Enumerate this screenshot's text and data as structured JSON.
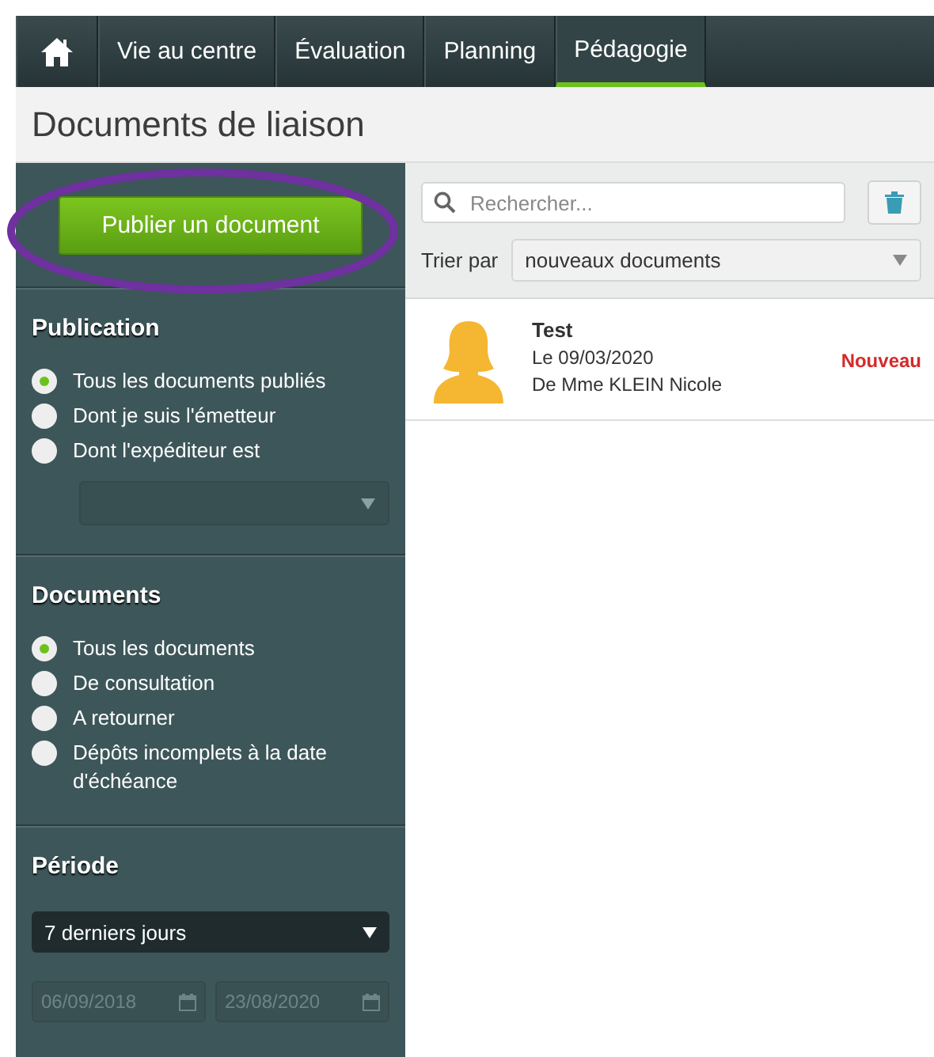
{
  "nav": {
    "tabs": [
      {
        "kind": "home",
        "selected": false
      },
      {
        "kind": "text",
        "label": "Vie au centre",
        "selected": false
      },
      {
        "kind": "text",
        "label": "Évaluation",
        "selected": false
      },
      {
        "kind": "text",
        "label": "Planning",
        "selected": false
      },
      {
        "kind": "text",
        "label": "Pédagogie",
        "selected": true
      }
    ]
  },
  "page_title": "Documents de liaison",
  "sidebar": {
    "publish_button": "Publier un document",
    "sections": [
      {
        "title": "Publication",
        "options": [
          {
            "label": "Tous les documents publiés",
            "selected": true
          },
          {
            "label": "Dont je suis l'émetteur",
            "selected": false
          },
          {
            "label": "Dont l'expéditeur est",
            "selected": false
          }
        ],
        "select": {
          "kind": "blank"
        }
      },
      {
        "title": "Documents",
        "options": [
          {
            "label": "Tous les documents",
            "selected": true
          },
          {
            "label": "De consultation",
            "selected": false
          },
          {
            "label": "A retourner",
            "selected": false
          },
          {
            "label": "Dépôts incomplets à la date d'échéance",
            "selected": false
          }
        ]
      },
      {
        "title": "Période",
        "select": {
          "kind": "dark",
          "value": "7 derniers jours"
        },
        "dates": [
          {
            "value": "06/09/2018",
            "disabled": true
          },
          {
            "value": "23/08/2020",
            "disabled": true
          }
        ]
      }
    ]
  },
  "search": {
    "placeholder": "Rechercher..."
  },
  "sort": {
    "label": "Trier par",
    "value": "nouveaux documents"
  },
  "documents": [
    {
      "title": "Test",
      "date": "Le 09/03/2020",
      "author": "De Mme KLEIN Nicole",
      "badge": "Nouveau"
    }
  ]
}
